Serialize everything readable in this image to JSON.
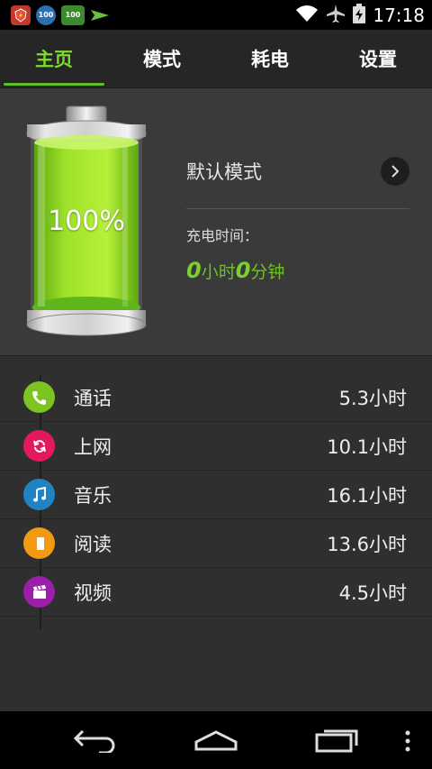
{
  "status_bar": {
    "time": "17:18",
    "notif_icons": [
      {
        "name": "app-shield-icon",
        "color": "#c0392b",
        "text": ""
      },
      {
        "name": "notification-100-icon",
        "color": "#2a6fb0",
        "text": "100"
      },
      {
        "name": "battery-100-icon",
        "color": "#3c8a2e",
        "text": "100"
      },
      {
        "name": "send-icon",
        "color": "#6cbf3a",
        "text": ""
      }
    ]
  },
  "tabs": [
    {
      "label": "主页",
      "active": true
    },
    {
      "label": "模式",
      "active": false
    },
    {
      "label": "耗电",
      "active": false
    },
    {
      "label": "设置",
      "active": false
    }
  ],
  "battery": {
    "percent_text": "100%",
    "level": 1.0,
    "colors": {
      "fill": "#8fdc1f",
      "fill_dark": "#4ea70d"
    }
  },
  "mode": {
    "label": "默认模式"
  },
  "charge": {
    "label": "充电时间：",
    "hours": "0",
    "hours_unit": "小时",
    "minutes": "0",
    "minutes_unit": "分钟"
  },
  "usage": [
    {
      "label": "通话",
      "value": "5.3小时",
      "icon": "phone-icon",
      "color": "#7cc41f"
    },
    {
      "label": "上网",
      "value": "10.1小时",
      "icon": "refresh-icon",
      "color": "#e3195e"
    },
    {
      "label": "音乐",
      "value": "16.1小时",
      "icon": "music-note-icon",
      "color": "#1f83c4"
    },
    {
      "label": "阅读",
      "value": "13.6小时",
      "icon": "book-icon",
      "color": "#f29b12"
    },
    {
      "label": "视频",
      "value": "4.5小时",
      "icon": "clapperboard-icon",
      "color": "#9b1fa8"
    }
  ]
}
